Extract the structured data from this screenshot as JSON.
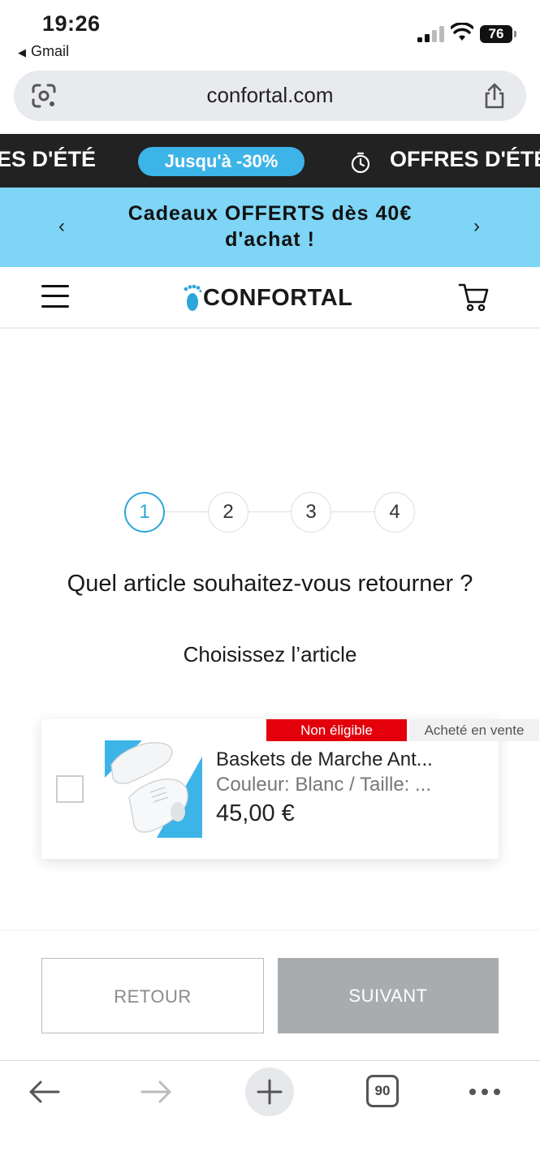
{
  "status_bar": {
    "time": "19:26",
    "back_app": "Gmail",
    "battery": "76"
  },
  "browser": {
    "url": "confortal.com"
  },
  "promo_strip": {
    "left_text": "ES D'ÉTÉ",
    "pill": "Jusqu'à -30%",
    "right_text": "OFFRES D'ÉTÉ"
  },
  "gift_banner": {
    "line1": "Cadeaux OFFERTS dès 40€",
    "line2": "d'achat !",
    "prev": "‹",
    "next": "›"
  },
  "header": {
    "logo_text": "CONFORTAL"
  },
  "stepper": {
    "steps": [
      "1",
      "2",
      "3",
      "4"
    ],
    "active": 1
  },
  "main": {
    "question": "Quel article souhaitez-vous retourner ?",
    "subtitle": "Choisissez l’article"
  },
  "item": {
    "badge_status": "Non éligible",
    "badge_purchase": "Acheté en vente",
    "name": "Baskets de Marche Ant...",
    "variant": "Couleur: Blanc / Taille: ...",
    "price": "45,00 €"
  },
  "actions": {
    "back_label": "RETOUR",
    "next_label": "SUIVANT"
  },
  "bottom_bar": {
    "tab_count": "90"
  },
  "colors": {
    "accent": "#2ba6db",
    "banner": "#7fd5f5",
    "badge_red": "#e3000b",
    "disabled_btn": "#a8acae"
  }
}
